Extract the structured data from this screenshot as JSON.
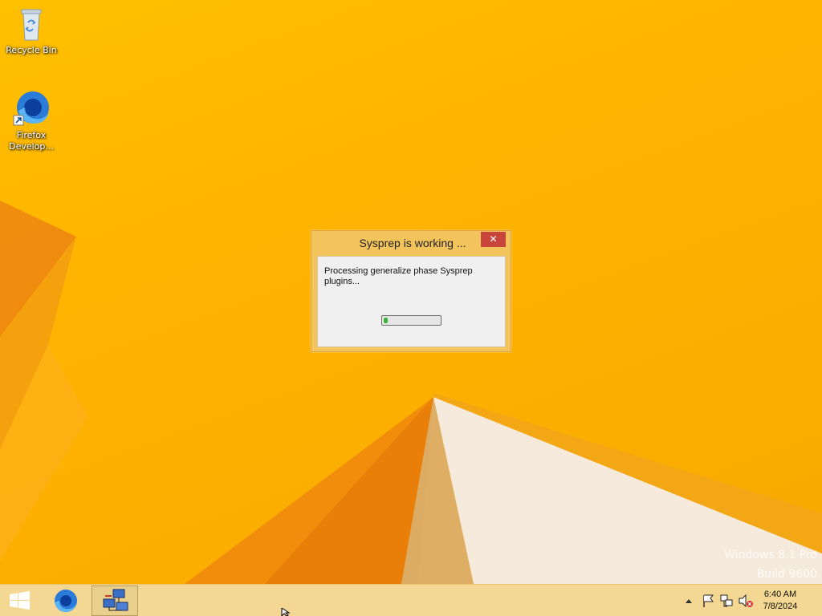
{
  "desktop": {
    "icons": [
      {
        "label": "Recycle Bin",
        "icon": "recycle-bin-icon"
      },
      {
        "label": "Firefox Develop...",
        "icon": "firefox-developer-icon"
      }
    ],
    "watermark": {
      "line1": "Windows 8.1 Pro",
      "line2": "Build 9600"
    }
  },
  "dialog": {
    "title": "Sysprep is working ...",
    "close_glyph": "✕",
    "message": "Processing generalize phase Sysprep plugins...",
    "progress_fraction": 0.05
  },
  "taskbar": {
    "pinned": [
      {
        "name": "start",
        "icon": "windows-start-icon"
      },
      {
        "name": "firefox",
        "icon": "firefox-icon"
      },
      {
        "name": "sysprep",
        "icon": "sysprep-app-icon"
      }
    ],
    "tray_icons": [
      "show-hidden-icons-chevron",
      "action-center-flag-icon",
      "network-icon",
      "volume-muted-icon"
    ],
    "clock": {
      "time": "6:40 AM",
      "date": "7/8/2024"
    }
  },
  "colors": {
    "wallpaper": "#ffb400",
    "taskbar": "#f3d793",
    "dialog_frame": "#f3c35c",
    "close_button": "#c7453b",
    "progress_fill": "#3bb33b"
  }
}
